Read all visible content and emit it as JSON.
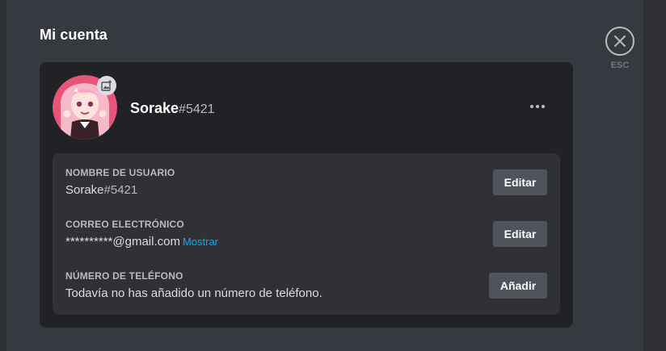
{
  "header": {
    "title": "Mi cuenta"
  },
  "close": {
    "esc_label": "ESC"
  },
  "profile": {
    "username": "Sorake",
    "discriminator": "#5421"
  },
  "fields": {
    "username": {
      "label": "NOMBRE DE USUARIO",
      "name": "Sorake",
      "discriminator": "#5421",
      "button": "Editar"
    },
    "email": {
      "label": "CORREO ELECTRÓNICO",
      "value": "**********@gmail.com",
      "reveal": "Mostrar",
      "button": "Editar"
    },
    "phone": {
      "label": "NÚMERO DE TELÉFONO",
      "value": "Todavía no has añadido un número de teléfono.",
      "button": "Añadir"
    }
  },
  "colors": {
    "background": "#36393f",
    "card": "#202225",
    "panel": "#2f3136",
    "button": "#4f545c",
    "link": "#00aff4",
    "avatar_bg": "#e8537a"
  },
  "icons": [
    "close-icon",
    "add-image-icon",
    "more-options-icon"
  ]
}
